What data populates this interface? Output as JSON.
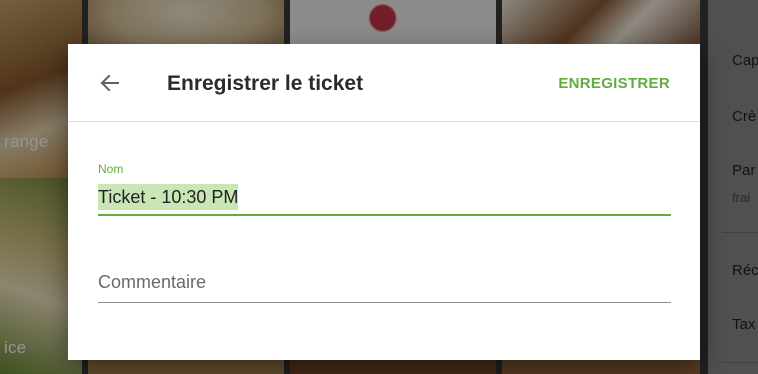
{
  "background": {
    "tiles": [
      {
        "label": "range"
      },
      {
        "label": "ice"
      }
    ]
  },
  "side_panel": {
    "items": [
      {
        "label": "Cap"
      },
      {
        "label": "Crè"
      },
      {
        "label": "Par",
        "sub": "frai"
      },
      {
        "label": "Réc"
      },
      {
        "label": "Tax"
      }
    ]
  },
  "dialog": {
    "title": "Enregistrer le ticket",
    "save_label": "ENREGISTRER",
    "back_icon": "arrow-left-icon",
    "name_field": {
      "label": "Nom",
      "value": "Ticket - 10:30 PM"
    },
    "comment_field": {
      "placeholder": "Commentaire",
      "value": ""
    }
  },
  "colors": {
    "accent": "#5fae3e",
    "selection": "#c9e6b6",
    "title_text": "#2b2b2b"
  }
}
